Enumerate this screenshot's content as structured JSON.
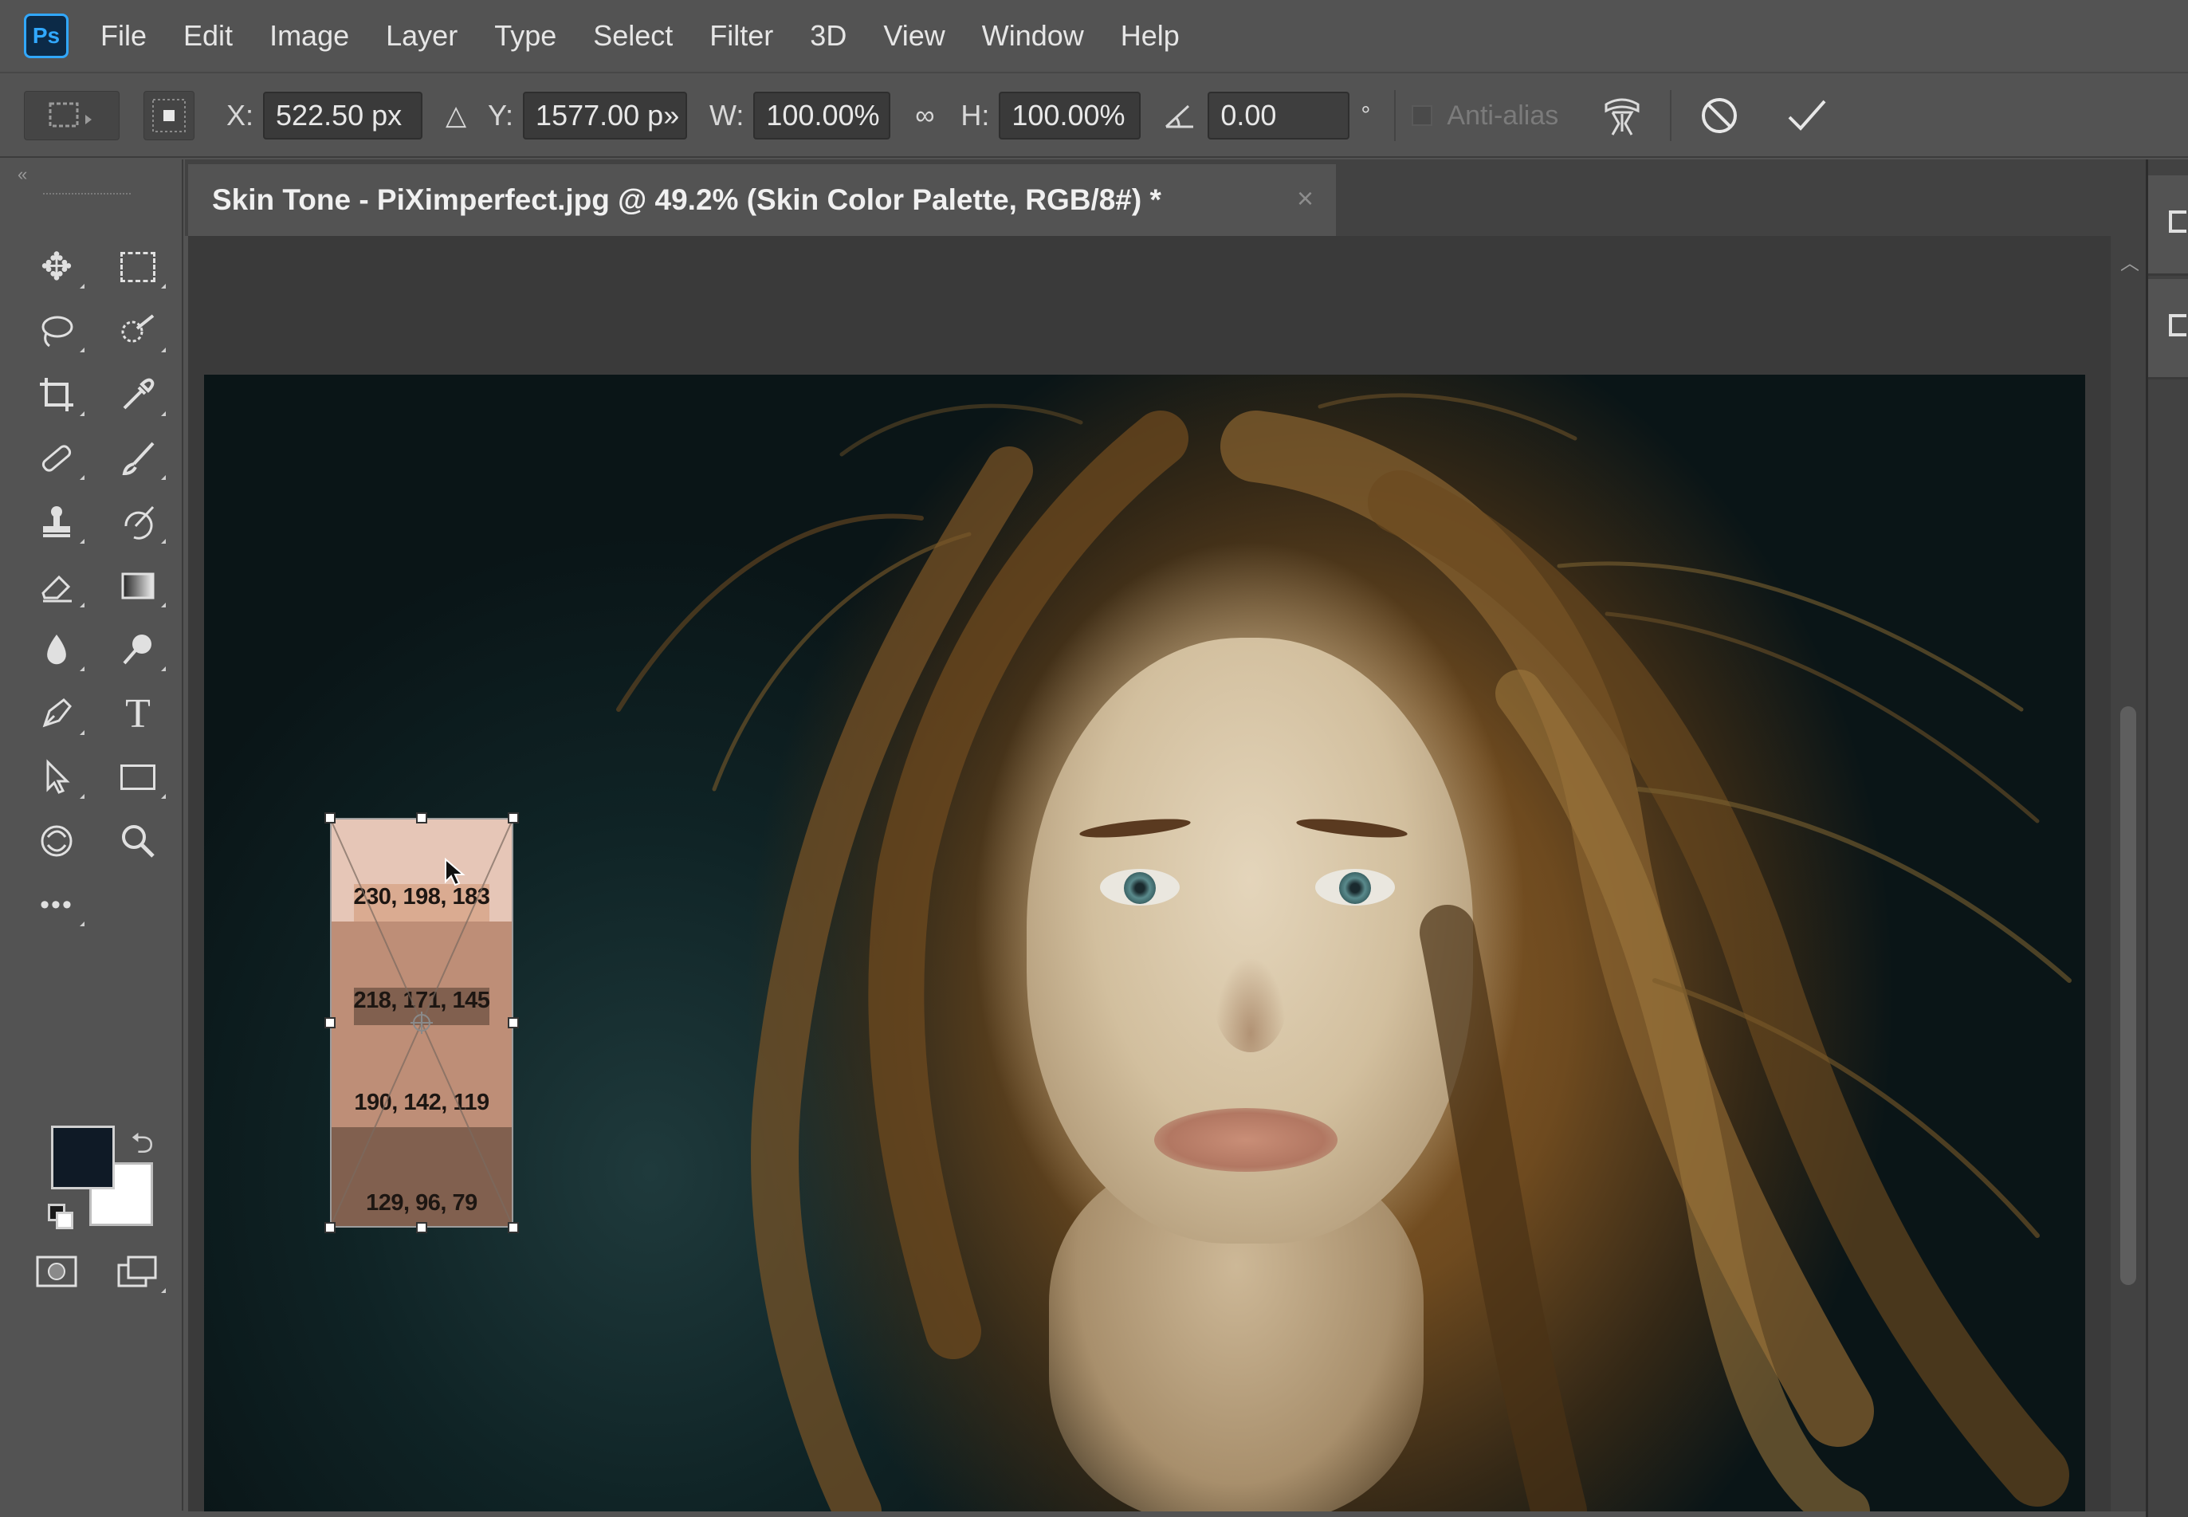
{
  "menubar": {
    "logo_text": "Ps",
    "items": [
      "File",
      "Edit",
      "Image",
      "Layer",
      "Type",
      "Select",
      "Filter",
      "3D",
      "View",
      "Window",
      "Help"
    ]
  },
  "options": {
    "x_label": "X:",
    "x_value": "522.50 px",
    "y_label": "Y:",
    "y_value": "1577.00 p»",
    "w_label": "W:",
    "w_value": "100.00%",
    "h_label": "H:",
    "h_value": "100.00%",
    "angle_value": "0.00",
    "degree_symbol": "°",
    "antialias_label": "Anti-alias"
  },
  "document": {
    "tab_title": "Skin Tone - PiXimperfect.jpg @ 49.2% (Skin Color Palette, RGB/8#) *",
    "close_glyph": "×"
  },
  "palette": {
    "swatches": [
      {
        "label": "230, 198, 183",
        "color": "#e6c6b7"
      },
      {
        "label": "218, 171, 145",
        "color": "#daab91"
      },
      {
        "label": "190, 142, 119",
        "color": "#be8e77"
      },
      {
        "label": "129, 96, 79",
        "color": "#81604f"
      }
    ]
  },
  "tools": {
    "more_glyph": "•••",
    "foreground_color": "#0f1a26",
    "background_color": "#ffffff"
  }
}
